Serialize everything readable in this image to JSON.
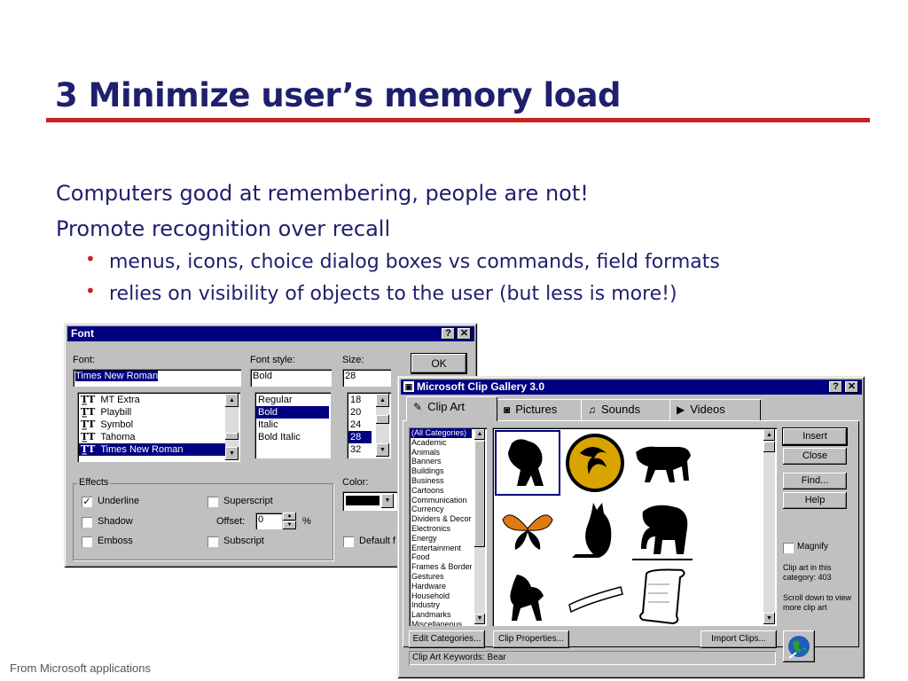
{
  "slide": {
    "title": "3 Minimize user’s memory load",
    "line1": "Computers good at remembering, people are not!",
    "line2": "Promote recognition over recall",
    "bullet1": "menus, icons, choice dialog boxes vs commands, field formats",
    "bullet2": "relies on visibility of objects to the user (but less is more!)",
    "bullet_glyph": "•",
    "footer": "From Microsoft applications"
  },
  "font_dialog": {
    "title": "Font",
    "help_btn": "?",
    "close_btn": "✕",
    "font_label": "Font:",
    "font_value": "Times New Roman",
    "style_label": "Font style:",
    "style_value": "Bold",
    "size_label": "Size:",
    "size_value": "28",
    "ok": "OK",
    "fonts": [
      "MT Extra",
      "Playbill",
      "Symbol",
      "Tahoma",
      "Times New Roman"
    ],
    "styles": [
      "Regular",
      "Bold",
      "Italic",
      "Bold Italic"
    ],
    "sizes": [
      "18",
      "20",
      "24",
      "28",
      "32"
    ],
    "effects_label": "Effects",
    "underline": "Underline",
    "shadow": "Shadow",
    "emboss": "Emboss",
    "superscript": "Superscript",
    "offset_label": "Offset:",
    "offset_value": "0",
    "percent": "%",
    "subscript": "Subscript",
    "color_label": "Color:",
    "default_label": "Default f",
    "underline_checked": true
  },
  "clip_dialog": {
    "title": "Microsoft Clip Gallery 3.0",
    "help_btn": "?",
    "close_btn": "✕",
    "tabs": [
      "Clip Art",
      "Pictures",
      "Sounds",
      "Videos"
    ],
    "categories": [
      "(All Categories)",
      "Academic",
      "Animals",
      "Banners",
      "Buildings",
      "Business",
      "Cartoons",
      "Communication",
      "Currency",
      "Dividers & Decora",
      "Electronics",
      "Energy",
      "Entertainment",
      "Food",
      "Frames & Borders",
      "Gestures",
      "Hardware",
      "Household",
      "Industry",
      "Landmarks",
      "Miscellaneous"
    ],
    "insert": "Insert",
    "close": "Close",
    "find": "Find...",
    "help": "Help",
    "magnify": "Magnify",
    "info1": "Clip art in this category: 403",
    "info2": "Scroll down to view more clip art",
    "edit_categories": "Edit Categories...",
    "clip_properties": "Clip Properties...",
    "import_clips": "Import Clips...",
    "keywords": "Clip Art Keywords:  Bear"
  }
}
